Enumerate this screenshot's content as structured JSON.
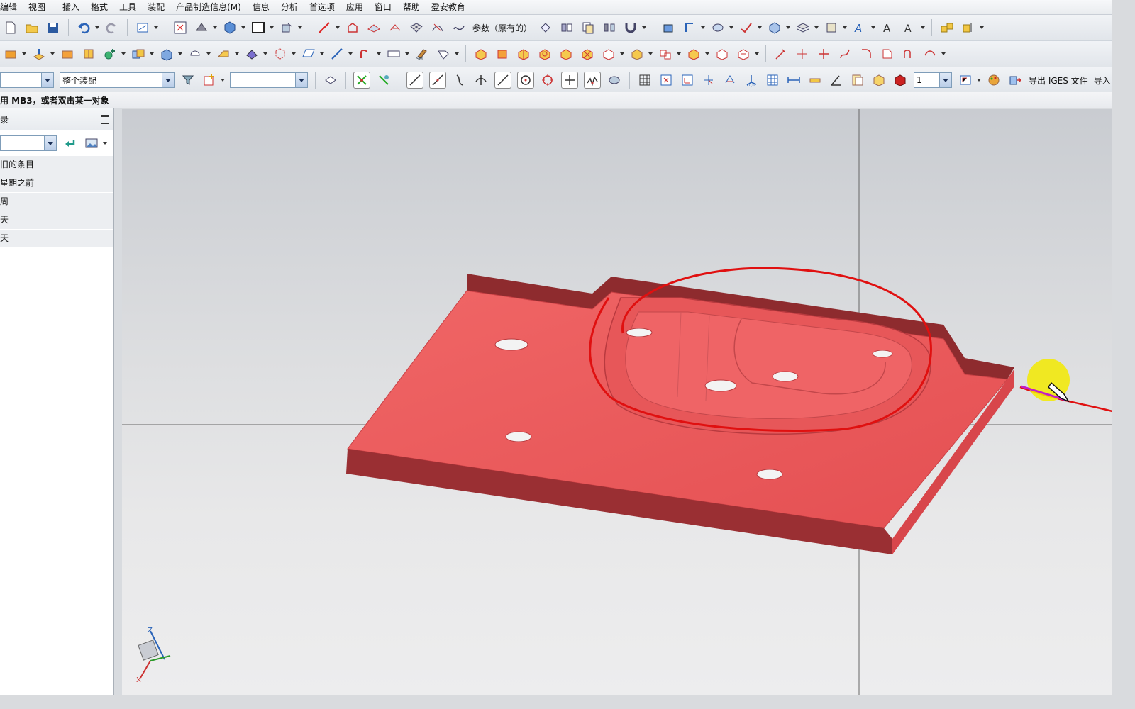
{
  "menu": [
    "编辑",
    "视图",
    "插入",
    "格式",
    "工具",
    "装配",
    "产品制造信息(M)",
    "信息",
    "分析",
    "首选项",
    "应用",
    "窗口",
    "帮助",
    "盈安教育"
  ],
  "toolbar1": {
    "params_label": "参数（原有的）"
  },
  "toolbar3": {
    "selection_filter": "",
    "assembly_scope": "整个装配",
    "layer_combo": "",
    "view_count": "1",
    "export_iges": "导出 IGES 文件",
    "import_label": "导入"
  },
  "status": {
    "prompt": "用 MB3，或者双击某一对象"
  },
  "navigator": {
    "title": "录",
    "filter_value": "",
    "rows": [
      "旧的条目",
      "星期之前",
      "周",
      "天",
      "天"
    ]
  },
  "triad": {
    "z": "Z",
    "x": "X"
  },
  "colors": {
    "part": "#ec5a5a",
    "annotation": "#e01010",
    "highlight": "#f3ea00",
    "background_top": "#c9ccd1",
    "background_bottom": "#ededee"
  }
}
